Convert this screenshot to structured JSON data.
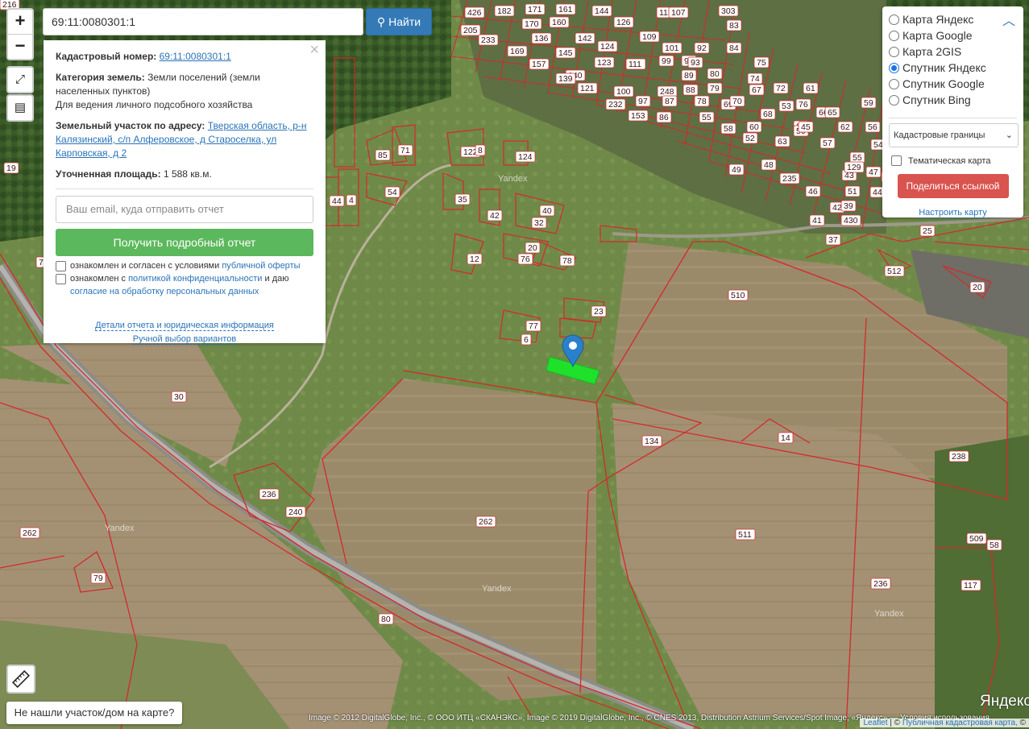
{
  "search": {
    "value": "69:11:0080301:1",
    "button_label": "Найти"
  },
  "zoom": {
    "in": "+",
    "out": "−"
  },
  "info": {
    "cad_label": "Кадастровый номер:",
    "cad_value": "69:11:0080301:1",
    "cat_label": "Категория земель:",
    "cat_value": "Земли поселений (земли населенных пунктов)",
    "usage": "Для ведения личного подсобного хозяйства",
    "addr_label": "Земельный участок по адресу:",
    "addr_value": "Тверская область, р-н Калязинский, с/п Алферовское, д Староселка, ул Карповская, д 2",
    "area_label": "Уточненная площадь:",
    "area_value": "1 588 кв.м.",
    "email_placeholder": "Ваш email, куда отправить отчет",
    "report_button": "Получить подробный отчет",
    "agree1_text": "ознакомлен и согласен с условиями",
    "agree1_link": "публичной оферты",
    "agree2_text": "ознакомлен с",
    "agree2_link": "политикой конфиденциальности",
    "agree2_mid": "и даю",
    "agree2_link2": "согласие на обработку персональных данных",
    "details_link": "Детали отчета и юридическая информация",
    "manual_link": "Ручной выбор вариантов"
  },
  "layers": {
    "options": [
      {
        "label": "Карта Яндекс",
        "selected": false
      },
      {
        "label": "Карта Google",
        "selected": false
      },
      {
        "label": "Карта 2GIS",
        "selected": false
      },
      {
        "label": "Спутник Яндекс",
        "selected": true
      },
      {
        "label": "Спутник Google",
        "selected": false
      },
      {
        "label": "Спутник Bing",
        "selected": false
      }
    ],
    "overlay_select": "Кадастровые границы",
    "thematic_label": "Тематическая карта",
    "share_button": "Поделиться ссылкой",
    "setup_link": "Настроить карту"
  },
  "map": {
    "parcel_labels": [
      "426",
      "182",
      "171",
      "161",
      "144",
      "113",
      "303",
      "205",
      "233",
      "170",
      "160",
      "126",
      "107",
      "83",
      "169",
      "136",
      "142",
      "124",
      "109",
      "101",
      "92",
      "84",
      "157",
      "145",
      "140",
      "123",
      "111",
      "99",
      "94",
      "93",
      "139",
      "121",
      "100",
      "248",
      "89",
      "80",
      "75",
      "232",
      "97",
      "87",
      "88",
      "79",
      "74",
      "153",
      "86",
      "78",
      "69",
      "67",
      "62",
      "61",
      "55",
      "70",
      "72",
      "66",
      "60",
      "53",
      "76",
      "65",
      "58",
      "52",
      "68",
      "63",
      "64",
      "57",
      "59",
      "50",
      "45",
      "62",
      "56",
      "49",
      "48",
      "235",
      "55",
      "47",
      "43",
      "54",
      "46",
      "51",
      "44",
      "129",
      "42",
      "39",
      "41",
      "40",
      "37",
      "430",
      "122",
      "85",
      "71",
      "8",
      "124",
      "54",
      "4",
      "44",
      "35",
      "42",
      "40",
      "32",
      "12",
      "20",
      "76",
      "78",
      "4",
      "23",
      "77",
      "6",
      "7",
      "19",
      "30",
      "134",
      "14",
      "238",
      "510",
      "511",
      "262",
      "236",
      "236",
      "240",
      "262",
      "79",
      "80",
      "117",
      "509",
      "58",
      "512",
      "20",
      "25",
      "1",
      "1",
      "216"
    ],
    "watermark": "Yandex",
    "logo": "Яндекс"
  },
  "attribution": {
    "imagery": "Image © 2012 DigitalGlobe, Inc., © ООО ИТЦ «СКАНЭКС», Image © 2019 DigitalGlobe, Inc., © CNES 2013, Distribution Astrium Services/Spot Image, «Яндекс» — Условия использования",
    "leaflet": "Leaflet",
    "separator": "| ©",
    "pkk": "Публичная кадастровая карта,",
    "tail": "©"
  },
  "not_found": "Не нашли участок/дом на карте?",
  "colors": {
    "parcel_border": "#d42a2a",
    "selected_parcel": "#1fe02b",
    "marker": "#2a81cb",
    "report_button": "#5cb85c",
    "share_button": "#d9534f",
    "search_button": "#337ab7"
  }
}
